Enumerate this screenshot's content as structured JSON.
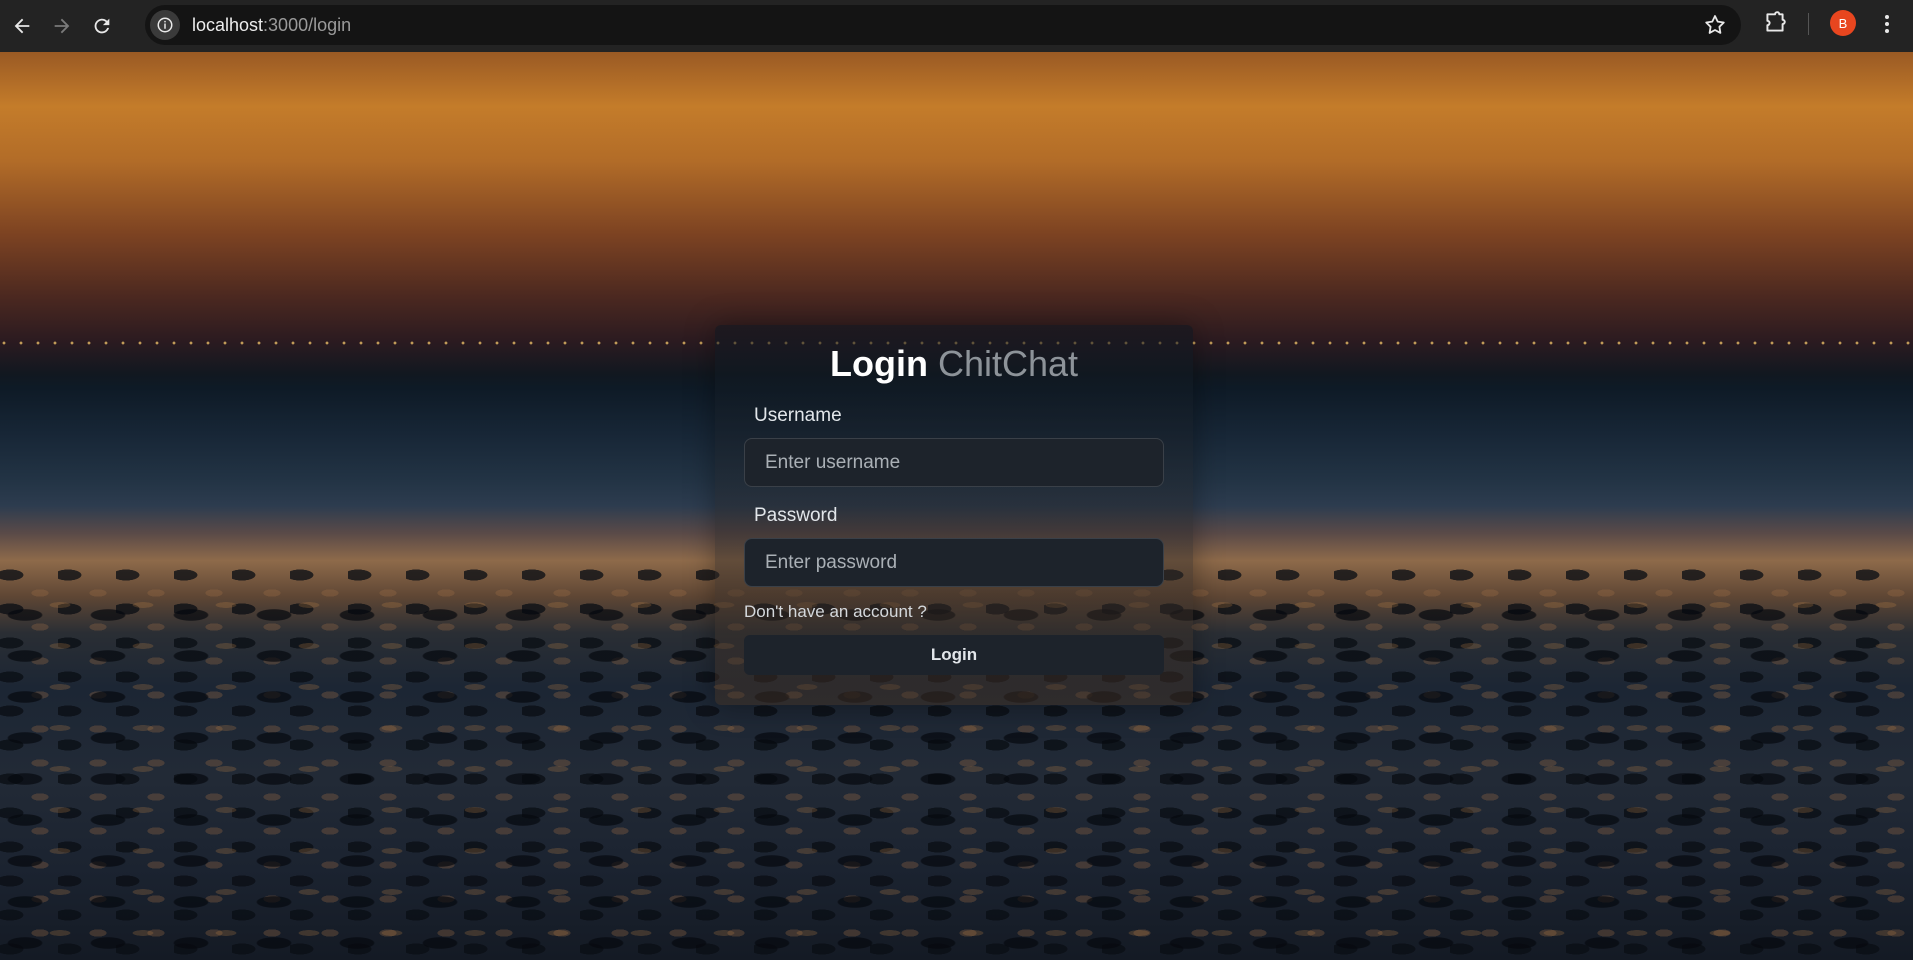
{
  "browser": {
    "url_host": "localhost",
    "url_path": ":3000/login",
    "profile_initial": "B",
    "profile_color": "#e8461f"
  },
  "login_form": {
    "title_main": "Login",
    "title_brand": "ChitChat",
    "username_label": "Username",
    "username_placeholder": "Enter username",
    "username_value": "",
    "password_label": "Password",
    "password_placeholder": "Enter password",
    "password_value": "",
    "signup_link": "Don't have an account ?",
    "submit_label": "Login"
  },
  "icons": {
    "back": "arrow-left-icon",
    "forward": "arrow-right-icon",
    "reload": "reload-icon",
    "site_info": "info-icon",
    "bookmark": "star-icon",
    "extensions": "puzzle-icon",
    "menu": "kebab-menu-icon"
  },
  "colors": {
    "card_input_bg": "#1d232b",
    "title_brand": "#8d9399"
  }
}
